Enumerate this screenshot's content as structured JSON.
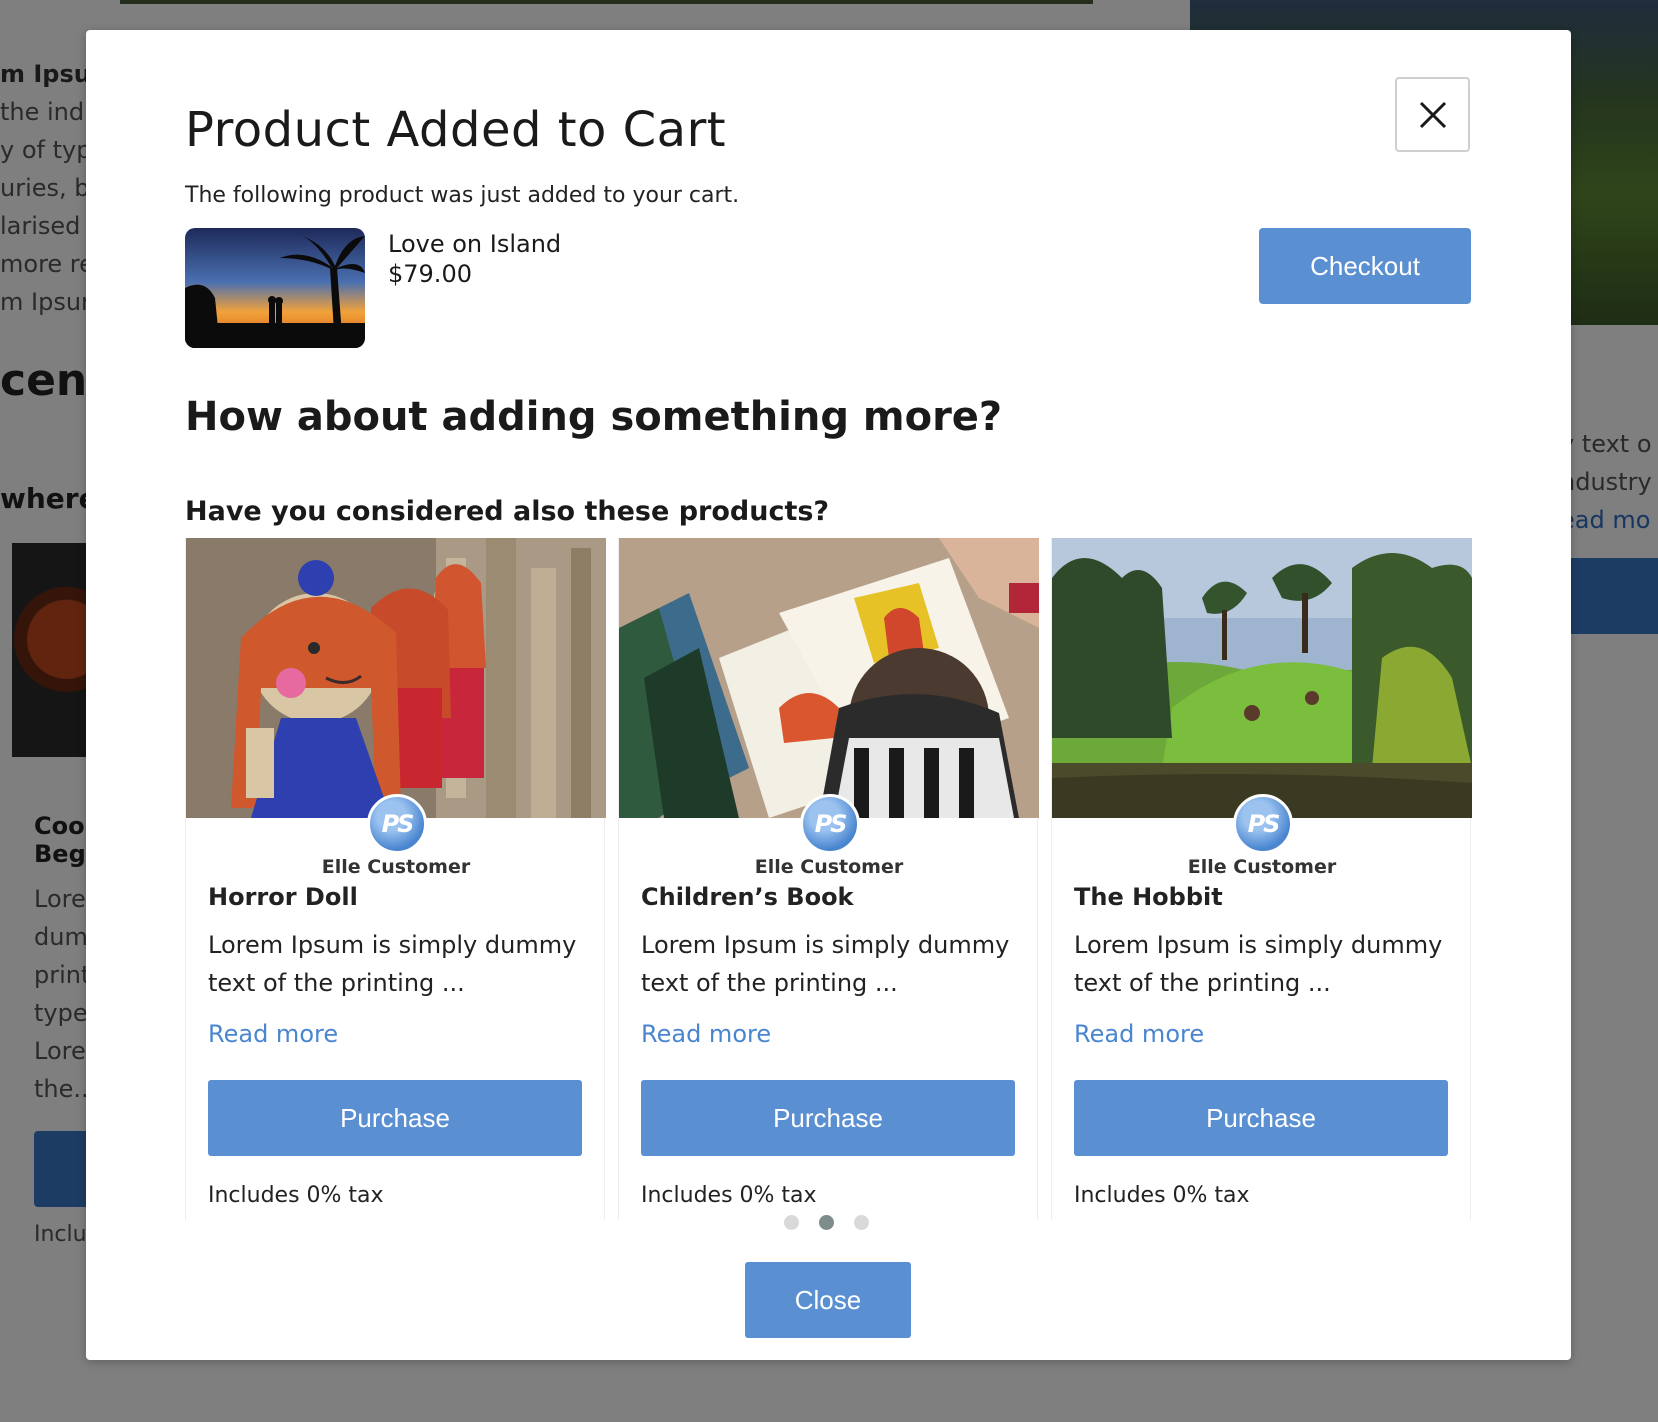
{
  "background": {
    "left_column_lines": [
      "m Ipsum",
      "the ind",
      "y of type",
      "uries, bu",
      "larised",
      "more re",
      "m Ipsum"
    ],
    "heading_fragment": "cent",
    "subheading_fragment": "where",
    "card_title_fragment": "Cool\nBeg",
    "card_body_lines": [
      "Lore",
      "dum",
      "print",
      "type",
      "Lore",
      "the..."
    ],
    "card_tax_fragment": "Inclu",
    "right_text_lines": [
      "y text o",
      "ndustry",
      "ead mo"
    ]
  },
  "modal": {
    "title": "Product Added to Cart",
    "subtitle": "The following product was just added to your cart.",
    "close_icon": "close-icon",
    "added_product": {
      "name": "Love on Island",
      "price": "$79.00"
    },
    "checkout_label": "Checkout",
    "upsell_heading": "How about adding something more?",
    "upsell_subheading": "Have you considered also these products?",
    "products": [
      {
        "author": "Elle Customer",
        "title": "Horror Doll",
        "description": "Lorem Ipsum is simply dummy text of the printing ...",
        "read_more": "Read more",
        "purchase_label": "Purchase",
        "tax_note": "Includes 0% tax"
      },
      {
        "author": "Elle Customer",
        "title": "Children’s Book",
        "description": "Lorem Ipsum is simply dummy text of the printing ...",
        "read_more": "Read more",
        "purchase_label": "Purchase",
        "tax_note": "Includes 0% tax"
      },
      {
        "author": "Elle Customer",
        "title": "The Hobbit",
        "description": "Lorem Ipsum is simply dummy text of the printing ...",
        "read_more": "Read more",
        "purchase_label": "Purchase",
        "tax_note": "Includes 0% tax"
      }
    ],
    "carousel": {
      "pages": 3,
      "active_page": 2
    },
    "close_label": "Close"
  },
  "colors": {
    "accent": "#5a8fd2",
    "link": "#4a86d0",
    "overlay": "#7d7d7d"
  }
}
